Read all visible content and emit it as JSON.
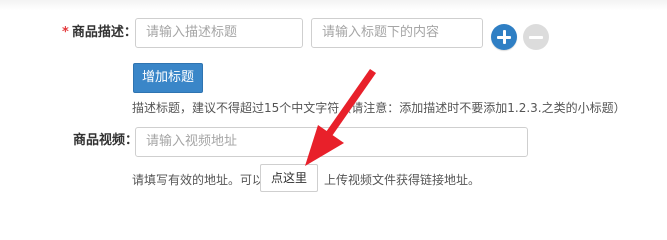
{
  "form": {
    "description": {
      "required_mark": "*",
      "label": "商品描述：",
      "title_input": {
        "value": "",
        "placeholder": "请输入描述标题"
      },
      "content_input": {
        "value": "",
        "placeholder": "请输入标题下的内容"
      },
      "add_title_button": "增加标题",
      "hint": "描述标题，建议不得超过15个中文字符（请注意：添加描述时不要添加1.2.3.之类的小标题）"
    },
    "video": {
      "label": "商品视频：",
      "url_input": {
        "value": "",
        "placeholder": "请输入视频地址"
      },
      "hint_before": "请填写有效的地址。可以",
      "click_here_button": "点这里",
      "hint_after": "上传视频文件获得链接地址。"
    }
  },
  "colors": {
    "required": "#e4393c",
    "primary": "#3a86c8",
    "plus_icon_bg": "#2f7fc4",
    "minus_icon_bg": "#dcdcdc",
    "arrow": "#e8202a"
  },
  "icons": {
    "add": "plus-circle-icon",
    "remove": "minus-circle-icon",
    "annotation": "red-arrow-annotation"
  }
}
